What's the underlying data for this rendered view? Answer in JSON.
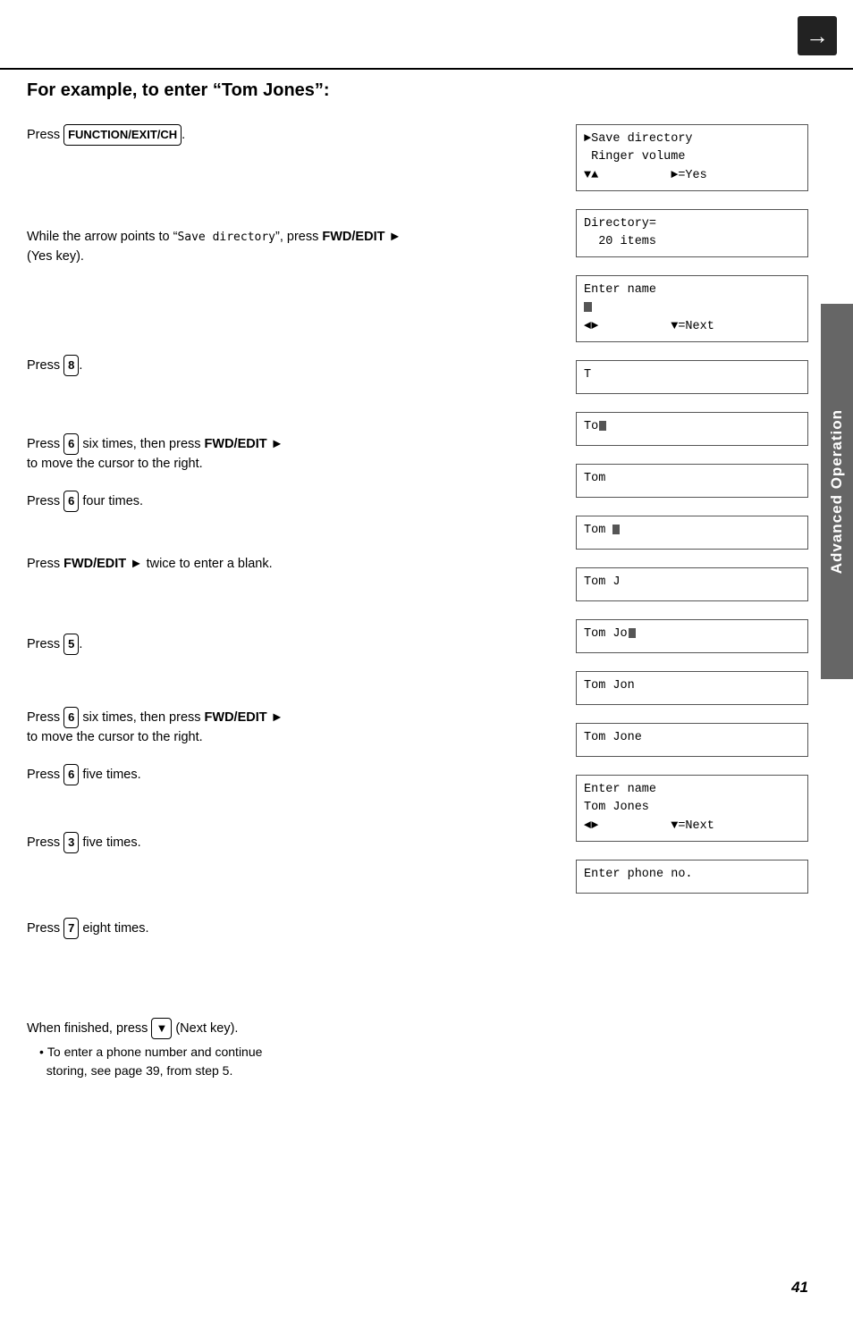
{
  "page": {
    "title": "For example, to enter “Tom Jones”:",
    "page_number": "41",
    "sidebar_label": "Advanced Operation"
  },
  "steps": [
    {
      "id": "step1",
      "text_parts": [
        {
          "type": "text",
          "val": "Press "
        },
        {
          "type": "key",
          "val": "FUNCTION/EXIT/CH"
        },
        {
          "type": "text",
          "val": "."
        }
      ]
    },
    {
      "id": "step2",
      "text_parts": [
        {
          "type": "text",
          "val": "While the arrow points to “Save directory”, press "
        },
        {
          "type": "bold",
          "val": "FWD/EDIT ►"
        },
        {
          "type": "text",
          "val": " (Yes key)."
        }
      ]
    },
    {
      "id": "step3",
      "text_parts": [
        {
          "type": "text",
          "val": "Press "
        },
        {
          "type": "key",
          "val": "8"
        },
        {
          "type": "text",
          "val": "."
        }
      ]
    },
    {
      "id": "step4",
      "text_parts": [
        {
          "type": "text",
          "val": "Press "
        },
        {
          "type": "key",
          "val": "6"
        },
        {
          "type": "text",
          "val": " six times, then press "
        },
        {
          "type": "bold",
          "val": "FWD/EDIT ►"
        },
        {
          "type": "text",
          "val": " to move the cursor to the right."
        }
      ]
    },
    {
      "id": "step4b",
      "text_parts": [
        {
          "type": "text",
          "val": "Press "
        },
        {
          "type": "key",
          "val": "6"
        },
        {
          "type": "text",
          "val": " four times."
        }
      ]
    },
    {
      "id": "step5",
      "text_parts": [
        {
          "type": "text",
          "val": "Press "
        },
        {
          "type": "bold",
          "val": "FWD/EDIT ►"
        },
        {
          "type": "text",
          "val": " twice to enter a blank."
        }
      ]
    },
    {
      "id": "step6",
      "text_parts": [
        {
          "type": "text",
          "val": "Press "
        },
        {
          "type": "key",
          "val": "5"
        },
        {
          "type": "text",
          "val": "."
        }
      ]
    },
    {
      "id": "step7",
      "text_parts": [
        {
          "type": "text",
          "val": "Press "
        },
        {
          "type": "key",
          "val": "6"
        },
        {
          "type": "text",
          "val": " six times, then press "
        },
        {
          "type": "bold",
          "val": "FWD/EDIT ►"
        },
        {
          "type": "text",
          "val": " to move the cursor to the right."
        }
      ]
    },
    {
      "id": "step7b",
      "text_parts": [
        {
          "type": "text",
          "val": "Press "
        },
        {
          "type": "key",
          "val": "6"
        },
        {
          "type": "text",
          "val": " five times."
        }
      ]
    },
    {
      "id": "step8",
      "text_parts": [
        {
          "type": "text",
          "val": "Press "
        },
        {
          "type": "key",
          "val": "3"
        },
        {
          "type": "text",
          "val": " five times."
        }
      ]
    },
    {
      "id": "step9",
      "text_parts": [
        {
          "type": "text",
          "val": "Press "
        },
        {
          "type": "key",
          "val": "7"
        },
        {
          "type": "text",
          "val": " eight times."
        }
      ]
    },
    {
      "id": "step10",
      "text_parts": [
        {
          "type": "text",
          "val": "When finished, press "
        },
        {
          "type": "key",
          "val": "▼"
        },
        {
          "type": "text",
          "val": " (Next key)."
        }
      ],
      "bullets": [
        "To enter a phone number and continue storing, see page 39, from step 5."
      ]
    }
  ],
  "lcd_screens": [
    {
      "id": "lcd1",
      "lines": [
        "►Save directory",
        " Ringer volume",
        "▼▲          ►=Yes"
      ]
    },
    {
      "id": "lcd2",
      "lines": [
        "Directory=",
        "  20 items"
      ]
    },
    {
      "id": "lcd3",
      "lines": [
        "Enter name",
        "■",
        "◄►          ▼=Next"
      ],
      "cursor_line": 1
    },
    {
      "id": "lcd4",
      "lines": [
        "T"
      ]
    },
    {
      "id": "lcd5",
      "lines": [
        "To■"
      ]
    },
    {
      "id": "lcd6",
      "lines": [
        "Tom"
      ]
    },
    {
      "id": "lcd7",
      "lines": [
        "Tom ■"
      ]
    },
    {
      "id": "lcd8",
      "lines": [
        "Tom J"
      ]
    },
    {
      "id": "lcd9",
      "lines": [
        "Tom Jo■"
      ]
    },
    {
      "id": "lcd10",
      "lines": [
        "Tom Jon"
      ]
    },
    {
      "id": "lcd11",
      "lines": [
        "Tom Jone"
      ]
    },
    {
      "id": "lcd12",
      "lines": [
        "Enter name",
        "Tom Jones",
        "◄►          ▼=Next"
      ]
    },
    {
      "id": "lcd13",
      "lines": [
        "Enter phone no."
      ]
    }
  ]
}
